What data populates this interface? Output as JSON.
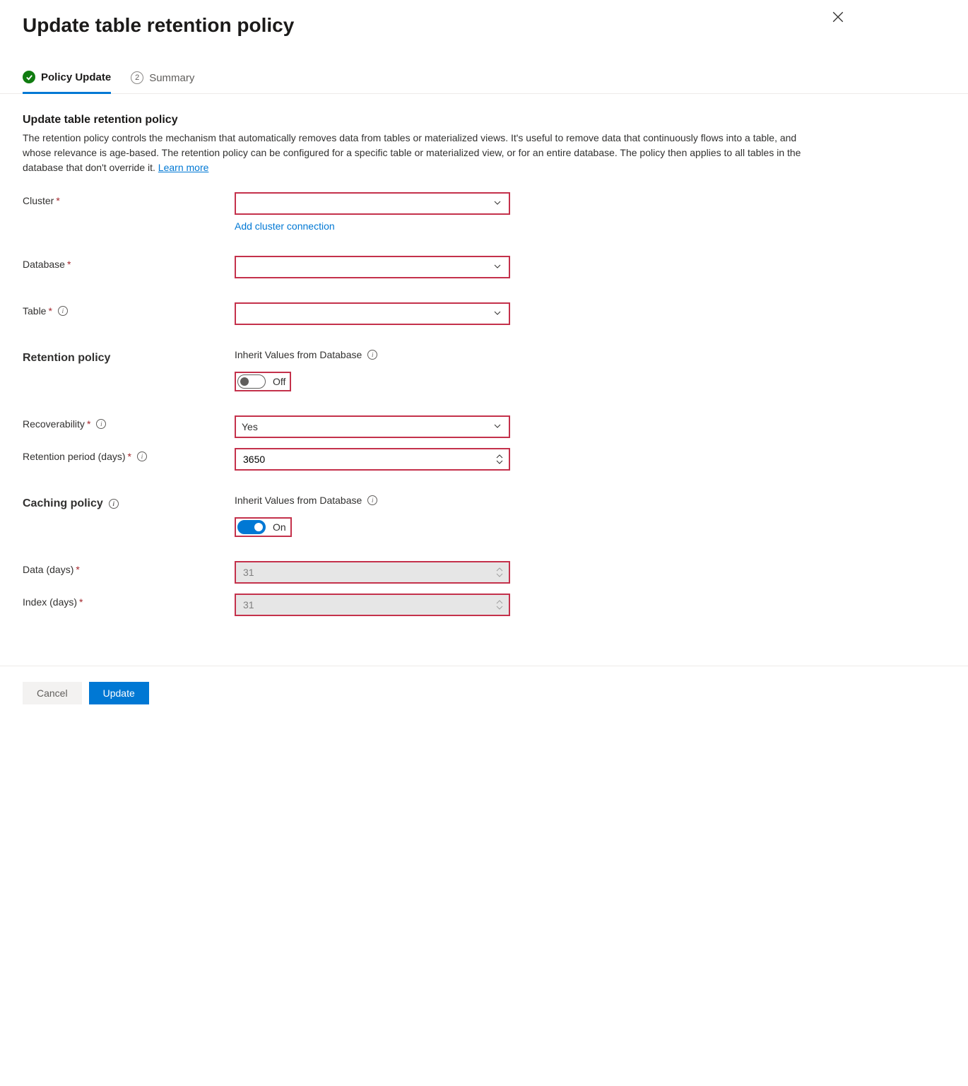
{
  "header": {
    "title": "Update table retention policy"
  },
  "tabs": {
    "policy_update": "Policy Update",
    "summary": "Summary",
    "summary_step_num": "2"
  },
  "intro": {
    "heading": "Update table retention policy",
    "description": "The retention policy controls the mechanism that automatically removes data from tables or materialized views. It's useful to remove data that continuously flows into a table, and whose relevance is age-based. The retention policy can be configured for a specific table or materialized view, or for an entire database. The policy then applies to all tables in the database that don't override it. ",
    "learn_more": "Learn more"
  },
  "fields": {
    "cluster_label": "Cluster",
    "add_cluster_link": "Add cluster connection",
    "database_label": "Database",
    "table_label": "Table",
    "retention_section": "Retention policy",
    "inherit_label": "Inherit Values from Database",
    "inherit_off": "Off",
    "inherit_on": "On",
    "recoverability_label": "Recoverability",
    "recoverability_value": "Yes",
    "retention_period_label": "Retention period (days)",
    "retention_period_value": "3650",
    "caching_section": "Caching policy",
    "data_days_label": "Data (days)",
    "data_days_value": "31",
    "index_days_label": "Index (days)",
    "index_days_value": "31"
  },
  "footer": {
    "cancel": "Cancel",
    "update": "Update"
  }
}
